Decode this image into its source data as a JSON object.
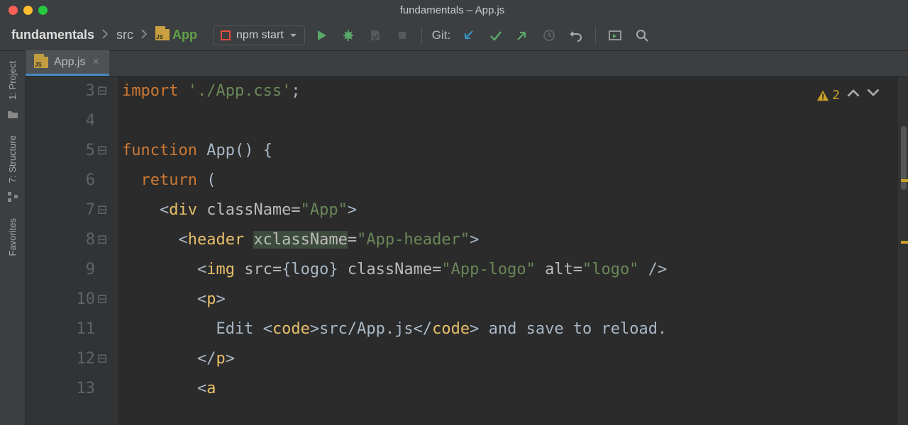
{
  "window": {
    "title": "fundamentals – App.js"
  },
  "breadcrumbs": {
    "root": "fundamentals",
    "src": "src",
    "app": "App"
  },
  "runConfig": {
    "label": "npm start"
  },
  "git": {
    "label": "Git:"
  },
  "sidebar": {
    "project": "1: Project",
    "structure": "7: Structure",
    "favorites": "Favorites"
  },
  "tab": {
    "name": "App.js"
  },
  "inspect": {
    "warnCount": "2"
  },
  "lines": {
    "n3": "3",
    "n4": "4",
    "n5": "5",
    "n6": "6",
    "n7": "7",
    "n8": "8",
    "n9": "9",
    "n10": "10",
    "n11": "11",
    "n12": "12",
    "n13": "13"
  },
  "code": {
    "l3_kw": "import ",
    "l3_str": "'./App.css'",
    "l3_end": ";",
    "l5_kw": "function ",
    "l5_name": "App",
    "l5_paren": "() {",
    "l6_kw": "  return ",
    "l6_op": "(",
    "l7_a": "    <",
    "l7_tag": "div ",
    "l7_attr": "className=",
    "l7_str": "\"App\"",
    "l7_z": ">",
    "l8_a": "      <",
    "l8_tag": "header ",
    "l8_attr": "xclassName",
    "l8_eq": "=",
    "l8_str": "\"App-header\"",
    "l8_z": ">",
    "l9_a": "        <",
    "l9_tag": "img ",
    "l9_at1": "src=",
    "l9_v1": "{logo} ",
    "l9_at2": "className=",
    "l9_v2": "\"App-logo\" ",
    "l9_at3": "alt=",
    "l9_v3": "\"logo\" ",
    "l9_z": "/>",
    "l10_a": "        <",
    "l10_tag": "p",
    "l10_z": ">",
    "l11_a": "          Edit ",
    "l11_b": "<",
    "l11_tag1": "code",
    "l11_c": ">",
    "l11_txt": "src/App.js",
    "l11_d": "</",
    "l11_tag2": "code",
    "l11_e": ">",
    "l11_f": " and save to reload.",
    "l12_a": "        </",
    "l12_tag": "p",
    "l12_z": ">",
    "l13_a": "        <",
    "l13_tag": "a"
  }
}
